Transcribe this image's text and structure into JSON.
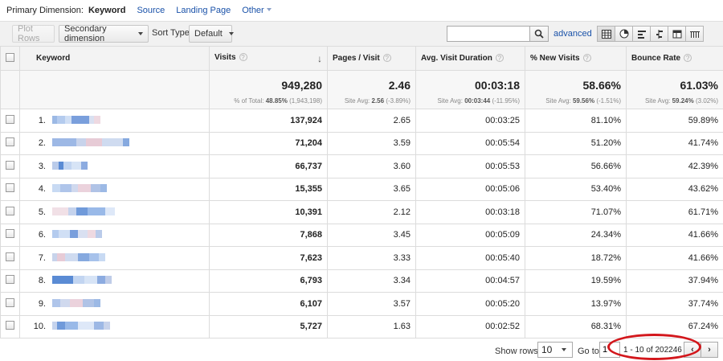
{
  "dimension_bar": {
    "label": "Primary Dimension:",
    "active": "Keyword",
    "options": [
      "Source",
      "Landing Page"
    ],
    "other": "Other"
  },
  "toolbar": {
    "plot_rows": "Plot Rows",
    "secondary_dimension": "Secondary dimension",
    "sort_type_label": "Sort Type:",
    "sort_type_value": "Default",
    "search_value": "",
    "advanced": "advanced"
  },
  "table": {
    "columns": [
      "Keyword",
      "Visits",
      "Pages / Visit",
      "Avg. Visit Duration",
      "% New Visits",
      "Bounce Rate"
    ],
    "totals": {
      "visits": "949,280",
      "visits_sub_label": "% of Total:",
      "visits_sub_value": "48.85%",
      "visits_sub_extra": "(1,943,198)",
      "pages": "2.46",
      "pages_sub_label": "Site Avg:",
      "pages_sub_value": "2.56",
      "pages_sub_extra": "(-3.89%)",
      "duration": "00:03:18",
      "duration_sub_label": "Site Avg:",
      "duration_sub_value": "00:03:44",
      "duration_sub_extra": "(-11.95%)",
      "new_visits": "58.66%",
      "new_visits_sub_label": "Site Avg:",
      "new_visits_sub_value": "59.56%",
      "new_visits_sub_extra": "(-1.51%)",
      "bounce": "61.03%",
      "bounce_sub_label": "Site Avg:",
      "bounce_sub_value": "59.24%",
      "bounce_sub_extra": "(3.02%)"
    },
    "rows": [
      {
        "num": "1.",
        "visits": "137,924",
        "pages": "2.65",
        "duration": "00:03:25",
        "new": "81.10%",
        "bounce": "59.89%"
      },
      {
        "num": "2.",
        "visits": "71,204",
        "pages": "3.59",
        "duration": "00:05:54",
        "new": "51.20%",
        "bounce": "41.74%"
      },
      {
        "num": "3.",
        "visits": "66,737",
        "pages": "3.60",
        "duration": "00:05:53",
        "new": "56.66%",
        "bounce": "42.39%"
      },
      {
        "num": "4.",
        "visits": "15,355",
        "pages": "3.65",
        "duration": "00:05:06",
        "new": "53.40%",
        "bounce": "43.62%"
      },
      {
        "num": "5.",
        "visits": "10,391",
        "pages": "2.12",
        "duration": "00:03:18",
        "new": "71.07%",
        "bounce": "61.71%"
      },
      {
        "num": "6.",
        "visits": "7,868",
        "pages": "3.45",
        "duration": "00:05:09",
        "new": "24.34%",
        "bounce": "41.66%"
      },
      {
        "num": "7.",
        "visits": "7,623",
        "pages": "3.33",
        "duration": "00:05:40",
        "new": "18.72%",
        "bounce": "41.66%"
      },
      {
        "num": "8.",
        "visits": "6,793",
        "pages": "3.34",
        "duration": "00:04:57",
        "new": "19.59%",
        "bounce": "37.94%"
      },
      {
        "num": "9.",
        "visits": "6,107",
        "pages": "3.57",
        "duration": "00:05:20",
        "new": "13.97%",
        "bounce": "37.74%"
      },
      {
        "num": "10.",
        "visits": "5,727",
        "pages": "1.63",
        "duration": "00:02:52",
        "new": "68.31%",
        "bounce": "67.24%"
      }
    ]
  },
  "pager": {
    "show_rows_label": "Show rows:",
    "show_rows_value": "10",
    "goto_label": "Go to:",
    "goto_value": "1",
    "range": "1 - 10 of 202246"
  },
  "colors": {
    "link": "#1a52a9",
    "highlight_circle": "#d3171c",
    "blur_blue": "#4a7fd0"
  },
  "icons": [
    "search-icon",
    "table-view-icon",
    "pie-view-icon",
    "performance-view-icon",
    "comparison-view-icon",
    "pivot-view-icon",
    "term-cloud-view-icon",
    "sort-desc-icon",
    "help-icon",
    "prev-page-icon",
    "next-page-icon"
  ]
}
